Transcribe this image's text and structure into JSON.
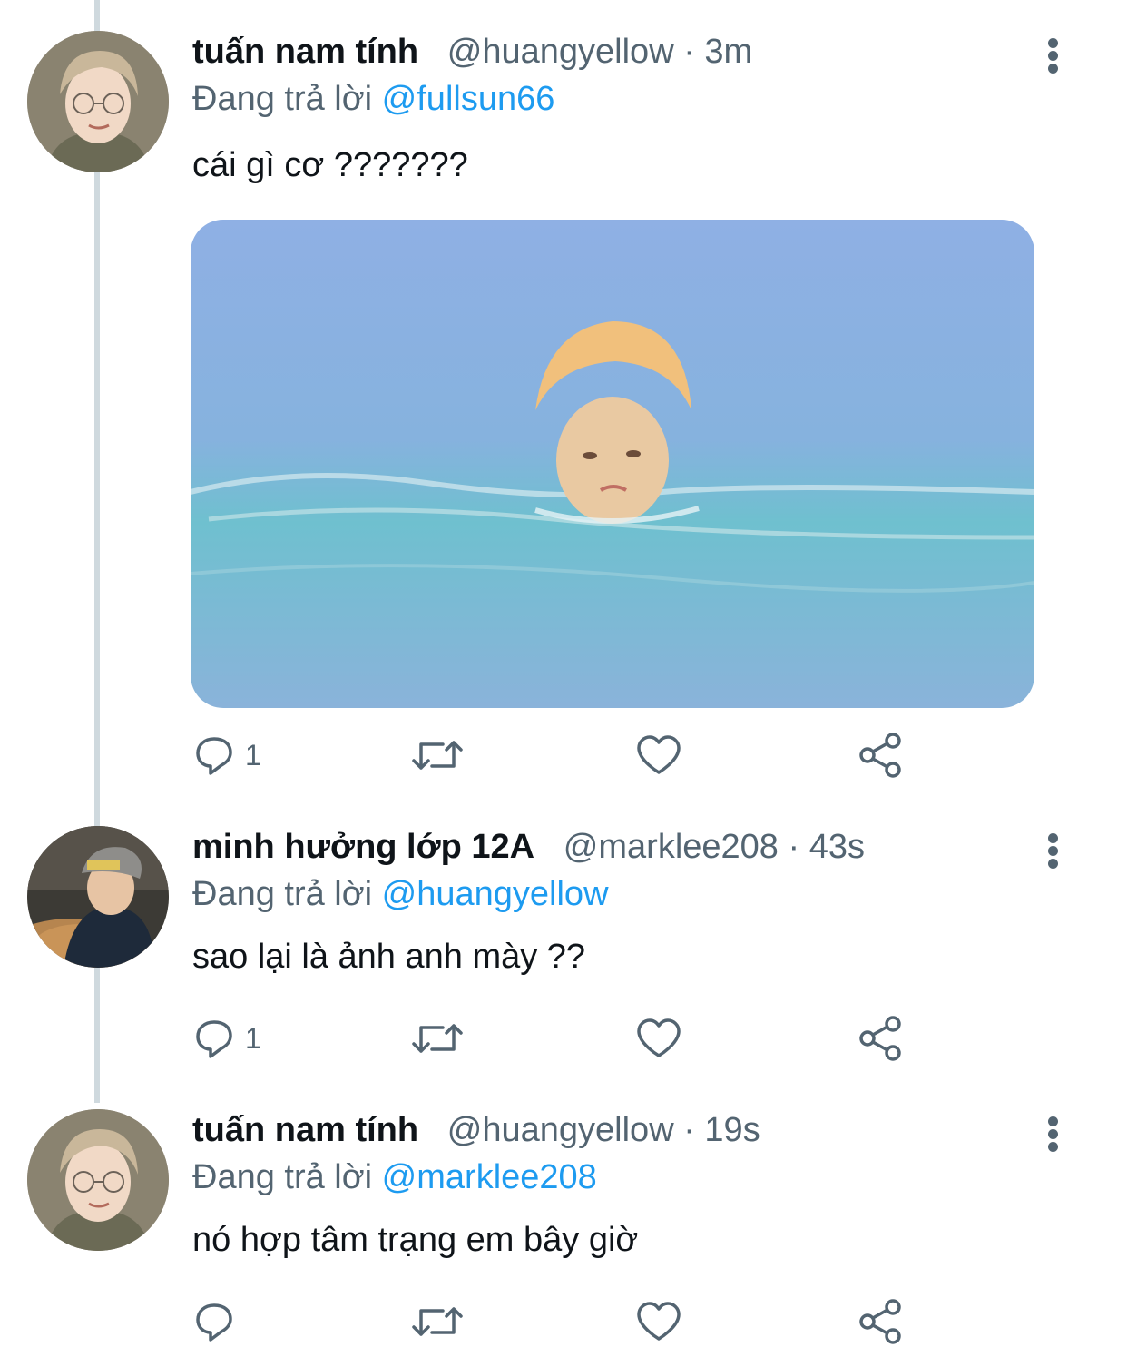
{
  "tweets": [
    {
      "name": "tuấn nam tính",
      "handle": "@huangyellow",
      "time": "3m",
      "replying_prefix": "Đang trả lời",
      "replying_to": "@fullsun66",
      "text": "cái gì cơ ???????",
      "has_media": true,
      "reply_count": "1",
      "icons": [
        "reply-icon",
        "retweet-icon",
        "like-icon",
        "share-icon",
        "more-icon"
      ]
    },
    {
      "name": "minh hưởng lớp 12A",
      "handle": "@marklee208",
      "time": "43s",
      "replying_prefix": "Đang trả lời",
      "replying_to": "@huangyellow",
      "text": "sao lại là ảnh anh mày ??",
      "has_media": false,
      "reply_count": "1",
      "icons": [
        "reply-icon",
        "retweet-icon",
        "like-icon",
        "share-icon",
        "more-icon"
      ]
    },
    {
      "name": "tuấn nam tính",
      "handle": "@huangyellow",
      "time": "19s",
      "replying_prefix": "Đang trả lời",
      "replying_to": "@marklee208",
      "text": "nó hợp tâm trạng em bây giờ",
      "has_media": false,
      "reply_count": "",
      "icons": [
        "reply-icon",
        "retweet-icon",
        "like-icon",
        "share-icon",
        "more-icon"
      ]
    }
  ],
  "colors": {
    "text": "#0f1419",
    "secondary": "#536471",
    "link": "#1d9bf0",
    "thread_line": "#cfd9de"
  }
}
